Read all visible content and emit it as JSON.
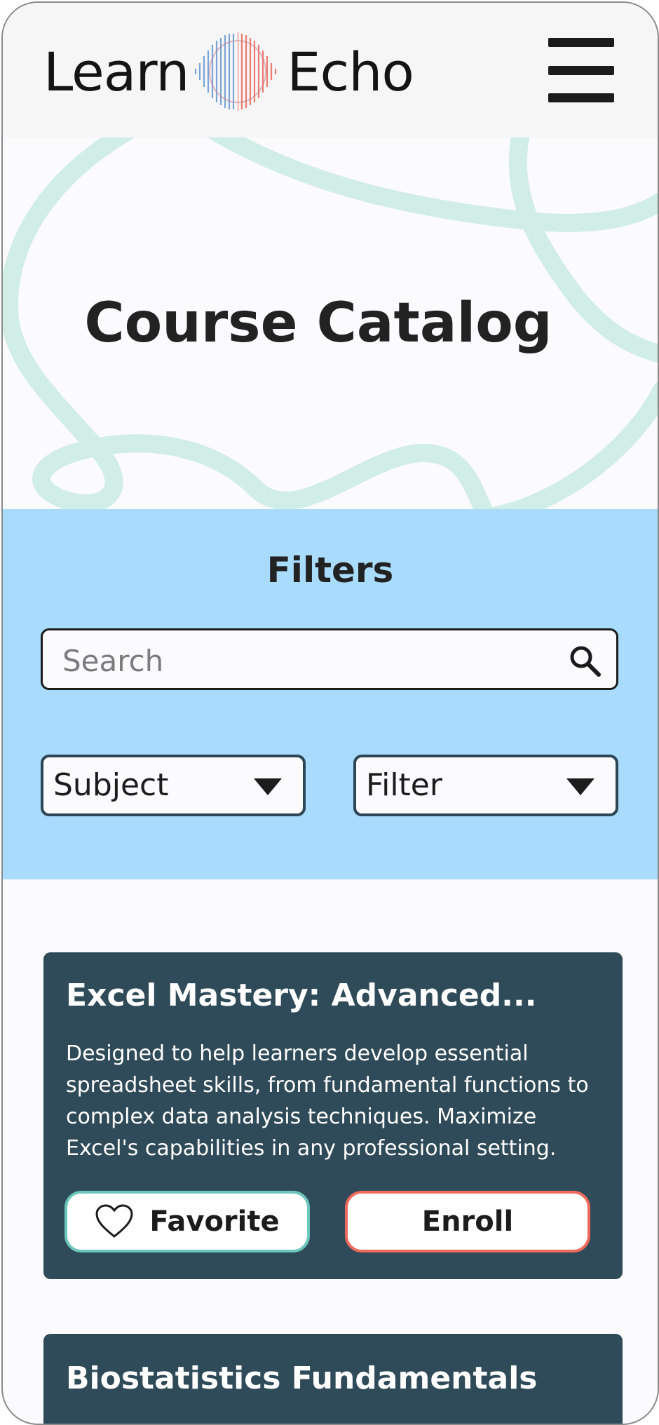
{
  "header": {
    "logo_left": "Learn",
    "logo_right": "Echo",
    "logo_icon": "waveform-logo-icon",
    "menu_icon": "hamburger-menu-icon"
  },
  "hero": {
    "title": "Course Catalog"
  },
  "filters": {
    "heading": "Filters",
    "search_placeholder": "Search",
    "search_value": "",
    "subject_select": "Subject",
    "filter_select": "Filter"
  },
  "courses": [
    {
      "title": "Excel Mastery: Advanced...",
      "description": "Designed to help learners develop essential spreadsheet skills, from fundamental functions to complex data analysis techniques. Maximize Excel's capabilities in any professional setting.",
      "favorite_label": "Favorite",
      "enroll_label": "Enroll"
    },
    {
      "title": "Biostatistics Fundamentals"
    }
  ],
  "colors": {
    "header_bg": "#f6f6f6",
    "filters_bg": "#a9dbfd",
    "card_bg": "#2f4a58",
    "favorite_border": "#6bc6bb",
    "enroll_border": "#ee6a5d",
    "hero_line": "#d0ede6"
  }
}
